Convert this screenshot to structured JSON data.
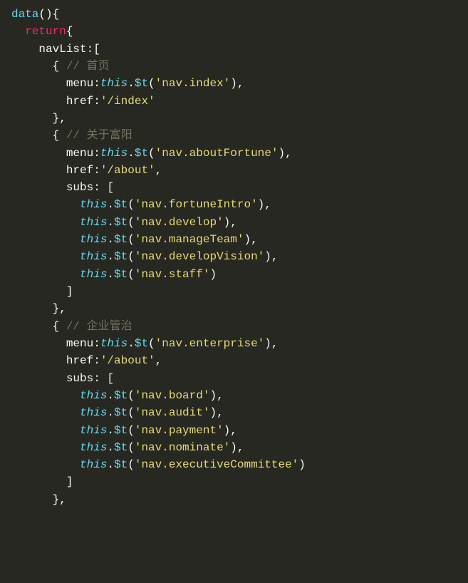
{
  "code": {
    "lines": [
      [
        {
          "c": "fn-name",
          "t": "data"
        },
        {
          "c": "paren",
          "t": "()"
        },
        {
          "c": "brace",
          "t": "{"
        }
      ],
      [
        {
          "c": null,
          "t": "  "
        },
        {
          "c": "kw",
          "t": "return"
        },
        {
          "c": "brace",
          "t": "{"
        }
      ],
      [
        {
          "c": null,
          "t": "    "
        },
        {
          "c": "prop",
          "t": "navList"
        },
        {
          "c": "punct",
          "t": ":"
        },
        {
          "c": "bracket",
          "t": "["
        }
      ],
      [
        {
          "c": null,
          "t": "      "
        },
        {
          "c": "brace",
          "t": "{"
        },
        {
          "c": null,
          "t": " "
        },
        {
          "c": "comment",
          "t": "// 首页"
        }
      ],
      [
        {
          "c": null,
          "t": "        "
        },
        {
          "c": "prop",
          "t": "menu"
        },
        {
          "c": "punct",
          "t": ":"
        },
        {
          "c": "this",
          "t": "this"
        },
        {
          "c": "punct",
          "t": "."
        },
        {
          "c": "method",
          "t": "$t"
        },
        {
          "c": "paren",
          "t": "("
        },
        {
          "c": "string",
          "t": "'nav.index'"
        },
        {
          "c": "paren",
          "t": ")"
        },
        {
          "c": "punct",
          "t": ","
        }
      ],
      [
        {
          "c": null,
          "t": "        "
        },
        {
          "c": "prop",
          "t": "href"
        },
        {
          "c": "punct",
          "t": ":"
        },
        {
          "c": "string",
          "t": "'/index'"
        }
      ],
      [
        {
          "c": null,
          "t": "      "
        },
        {
          "c": "brace",
          "t": "}"
        },
        {
          "c": "punct",
          "t": ","
        }
      ],
      [
        {
          "c": null,
          "t": "      "
        },
        {
          "c": "brace",
          "t": "{"
        },
        {
          "c": null,
          "t": " "
        },
        {
          "c": "comment",
          "t": "// 关于富阳"
        }
      ],
      [
        {
          "c": null,
          "t": "        "
        },
        {
          "c": "prop",
          "t": "menu"
        },
        {
          "c": "punct",
          "t": ":"
        },
        {
          "c": "this",
          "t": "this"
        },
        {
          "c": "punct",
          "t": "."
        },
        {
          "c": "method",
          "t": "$t"
        },
        {
          "c": "paren",
          "t": "("
        },
        {
          "c": "string",
          "t": "'nav.aboutFortune'"
        },
        {
          "c": "paren",
          "t": ")"
        },
        {
          "c": "punct",
          "t": ","
        }
      ],
      [
        {
          "c": null,
          "t": "        "
        },
        {
          "c": "prop",
          "t": "href"
        },
        {
          "c": "punct",
          "t": ":"
        },
        {
          "c": "string",
          "t": "'/about'"
        },
        {
          "c": "punct",
          "t": ","
        }
      ],
      [
        {
          "c": null,
          "t": "        "
        },
        {
          "c": "prop",
          "t": "subs"
        },
        {
          "c": "punct",
          "t": ": "
        },
        {
          "c": "bracket",
          "t": "["
        }
      ],
      [
        {
          "c": null,
          "t": "          "
        },
        {
          "c": "this",
          "t": "this"
        },
        {
          "c": "punct",
          "t": "."
        },
        {
          "c": "method",
          "t": "$t"
        },
        {
          "c": "paren",
          "t": "("
        },
        {
          "c": "string",
          "t": "'nav.fortuneIntro'"
        },
        {
          "c": "paren",
          "t": ")"
        },
        {
          "c": "punct",
          "t": ","
        }
      ],
      [
        {
          "c": null,
          "t": "          "
        },
        {
          "c": "this",
          "t": "this"
        },
        {
          "c": "punct",
          "t": "."
        },
        {
          "c": "method",
          "t": "$t"
        },
        {
          "c": "paren",
          "t": "("
        },
        {
          "c": "string",
          "t": "'nav.develop'"
        },
        {
          "c": "paren",
          "t": ")"
        },
        {
          "c": "punct",
          "t": ","
        }
      ],
      [
        {
          "c": null,
          "t": "          "
        },
        {
          "c": "this",
          "t": "this"
        },
        {
          "c": "punct",
          "t": "."
        },
        {
          "c": "method",
          "t": "$t"
        },
        {
          "c": "paren",
          "t": "("
        },
        {
          "c": "string",
          "t": "'nav.manageTeam'"
        },
        {
          "c": "paren",
          "t": ")"
        },
        {
          "c": "punct",
          "t": ","
        }
      ],
      [
        {
          "c": null,
          "t": "          "
        },
        {
          "c": "this",
          "t": "this"
        },
        {
          "c": "punct",
          "t": "."
        },
        {
          "c": "method",
          "t": "$t"
        },
        {
          "c": "paren",
          "t": "("
        },
        {
          "c": "string",
          "t": "'nav.developVision'"
        },
        {
          "c": "paren",
          "t": ")"
        },
        {
          "c": "punct",
          "t": ","
        }
      ],
      [
        {
          "c": null,
          "t": "          "
        },
        {
          "c": "this",
          "t": "this"
        },
        {
          "c": "punct",
          "t": "."
        },
        {
          "c": "method",
          "t": "$t"
        },
        {
          "c": "paren",
          "t": "("
        },
        {
          "c": "string",
          "t": "'nav.staff'"
        },
        {
          "c": "paren",
          "t": ")"
        }
      ],
      [
        {
          "c": null,
          "t": "        "
        },
        {
          "c": "bracket",
          "t": "]"
        }
      ],
      [
        {
          "c": null,
          "t": "      "
        },
        {
          "c": "brace",
          "t": "}"
        },
        {
          "c": "punct",
          "t": ","
        }
      ],
      [
        {
          "c": null,
          "t": "      "
        },
        {
          "c": "brace",
          "t": "{"
        },
        {
          "c": null,
          "t": " "
        },
        {
          "c": "comment",
          "t": "// 企业管治"
        }
      ],
      [
        {
          "c": null,
          "t": "        "
        },
        {
          "c": "prop",
          "t": "menu"
        },
        {
          "c": "punct",
          "t": ":"
        },
        {
          "c": "this",
          "t": "this"
        },
        {
          "c": "punct",
          "t": "."
        },
        {
          "c": "method",
          "t": "$t"
        },
        {
          "c": "paren",
          "t": "("
        },
        {
          "c": "string",
          "t": "'nav.enterprise'"
        },
        {
          "c": "paren",
          "t": ")"
        },
        {
          "c": "punct",
          "t": ","
        }
      ],
      [
        {
          "c": null,
          "t": "        "
        },
        {
          "c": "prop",
          "t": "href"
        },
        {
          "c": "punct",
          "t": ":"
        },
        {
          "c": "string",
          "t": "'/about'"
        },
        {
          "c": "punct",
          "t": ","
        }
      ],
      [
        {
          "c": null,
          "t": "        "
        },
        {
          "c": "prop",
          "t": "subs"
        },
        {
          "c": "punct",
          "t": ": "
        },
        {
          "c": "bracket",
          "t": "["
        }
      ],
      [
        {
          "c": null,
          "t": "          "
        },
        {
          "c": "this",
          "t": "this"
        },
        {
          "c": "punct",
          "t": "."
        },
        {
          "c": "method",
          "t": "$t"
        },
        {
          "c": "paren",
          "t": "("
        },
        {
          "c": "string",
          "t": "'nav.board'"
        },
        {
          "c": "paren",
          "t": ")"
        },
        {
          "c": "punct",
          "t": ","
        }
      ],
      [
        {
          "c": null,
          "t": "          "
        },
        {
          "c": "this",
          "t": "this"
        },
        {
          "c": "punct",
          "t": "."
        },
        {
          "c": "method",
          "t": "$t"
        },
        {
          "c": "paren",
          "t": "("
        },
        {
          "c": "string",
          "t": "'nav.audit'"
        },
        {
          "c": "paren",
          "t": ")"
        },
        {
          "c": "punct",
          "t": ","
        }
      ],
      [
        {
          "c": null,
          "t": "          "
        },
        {
          "c": "this",
          "t": "this"
        },
        {
          "c": "punct",
          "t": "."
        },
        {
          "c": "method",
          "t": "$t"
        },
        {
          "c": "paren",
          "t": "("
        },
        {
          "c": "string",
          "t": "'nav.payment'"
        },
        {
          "c": "paren",
          "t": ")"
        },
        {
          "c": "punct",
          "t": ","
        }
      ],
      [
        {
          "c": null,
          "t": "          "
        },
        {
          "c": "this",
          "t": "this"
        },
        {
          "c": "punct",
          "t": "."
        },
        {
          "c": "method",
          "t": "$t"
        },
        {
          "c": "paren",
          "t": "("
        },
        {
          "c": "string",
          "t": "'nav.nominate'"
        },
        {
          "c": "paren",
          "t": ")"
        },
        {
          "c": "punct",
          "t": ","
        }
      ],
      [
        {
          "c": null,
          "t": "          "
        },
        {
          "c": "this",
          "t": "this"
        },
        {
          "c": "punct",
          "t": "."
        },
        {
          "c": "method",
          "t": "$t"
        },
        {
          "c": "paren",
          "t": "("
        },
        {
          "c": "string",
          "t": "'nav.executiveCommittee'"
        },
        {
          "c": "paren",
          "t": ")"
        }
      ],
      [
        {
          "c": null,
          "t": "        "
        },
        {
          "c": "bracket",
          "t": "]"
        }
      ],
      [
        {
          "c": null,
          "t": "      "
        },
        {
          "c": "brace",
          "t": "}"
        },
        {
          "c": "punct",
          "t": ","
        }
      ]
    ]
  }
}
